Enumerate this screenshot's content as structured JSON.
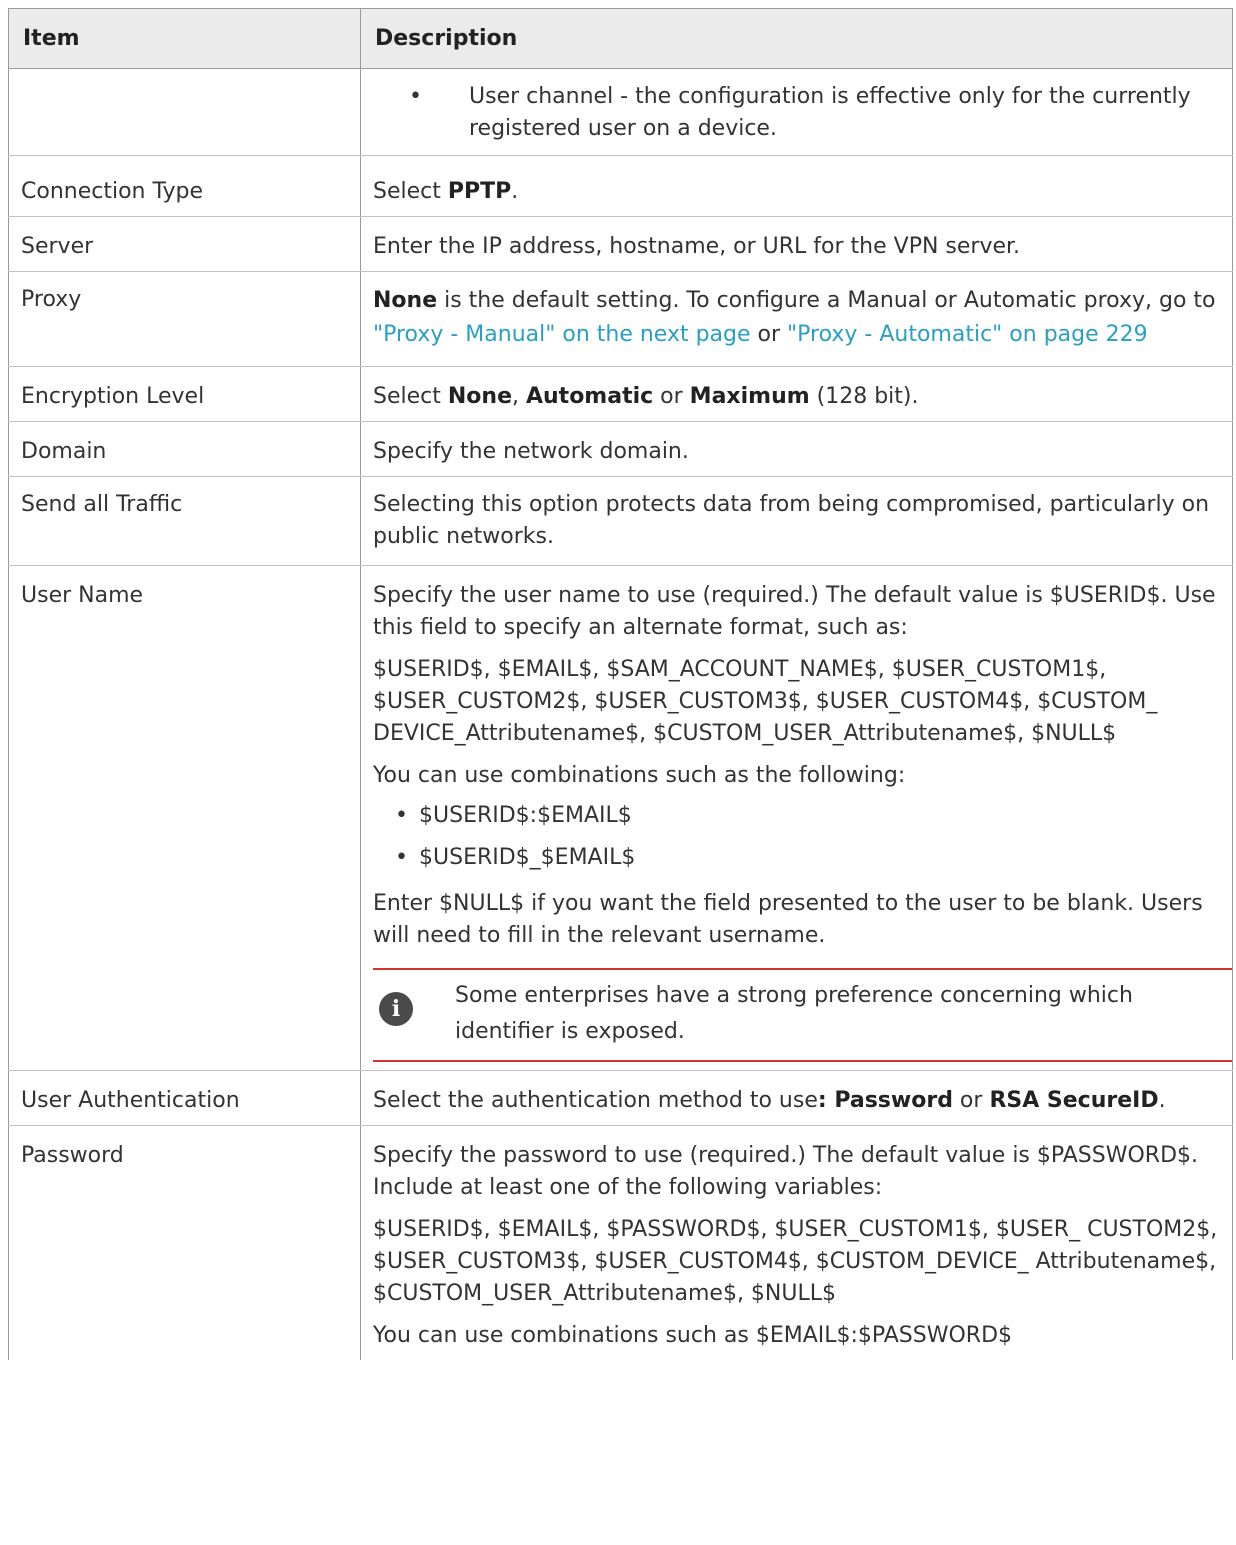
{
  "table": {
    "headers": {
      "item": "Item",
      "description": "Description"
    },
    "user_channel": "User channel - the configuration is effective only for the currently registered user on a device.",
    "connection_type": {
      "item": "Connection Type",
      "pre": "Select ",
      "bold": "PPTP",
      "post": "."
    },
    "server": {
      "item": "Server",
      "text": "Enter the IP address, hostname, or URL for the VPN server."
    },
    "proxy": {
      "item": "Proxy",
      "bold": "None",
      "text1": " is the default setting. To configure a Manual or Automatic proxy, go to ",
      "link1": "\"Proxy - Manual\" on the next page",
      "text2": " or ",
      "link2": "\"Proxy - Automatic\" on page 229"
    },
    "encryption": {
      "item": "Encryption Level",
      "pre": "Select ",
      "opt1": "None",
      "sep1": ", ",
      "opt2": "Automatic",
      "sep2": " or ",
      "opt3": "Maximum",
      "post": " (128 bit)."
    },
    "domain": {
      "item": "Domain",
      "text": "Specify the network domain."
    },
    "send_all": {
      "item": "Send all Traffic",
      "text": "Selecting this option protects data from being compromised, particularly on public networks."
    },
    "user_name": {
      "item": "User Name",
      "p1": "Specify the user name to use (required.) The default value is $USERID$. Use this field to specify an alternate format, such as:",
      "p2": "$USERID$, $EMAIL$, $SAM_ACCOUNT_NAME$, $USER_CUSTOM1$, $USER_CUSTOM2$, $USER_CUSTOM3$, $USER_CUSTOM4$, $CUSTOM_ DEVICE_Attributename$, $CUSTOM_USER_Attributename$, $NULL$",
      "p3": "You can use combinations such as the following:",
      "combos": [
        "$USERID$:$EMAIL$",
        "$USERID$_$EMAIL$"
      ],
      "p4": "Enter $NULL$ if you want the field presented to the user to be blank. Users will need to fill in the relevant username.",
      "note": "Some enterprises have a strong preference concerning which identifier is exposed."
    },
    "user_auth": {
      "item": "User Authentication",
      "pre": "Select the authentication method to use",
      "colon": ":",
      "opt1": " Password",
      "sep": " or ",
      "opt2": "RSA SecureID",
      "post": "."
    },
    "password": {
      "item": "Password",
      "p1": "Specify the password to use (required.) The default value is $PASSWORD$. Include at least one of the following variables:",
      "p2": "$USERID$, $EMAIL$, $PASSWORD$, $USER_CUSTOM1$, $USER_ CUSTOM2$, $USER_CUSTOM3$, $USER_CUSTOM4$, $CUSTOM_DEVICE_ Attributename$, $CUSTOM_USER_Attributename$, $NULL$",
      "p3": "You can use combinations such as $EMAIL$:$PASSWORD$"
    }
  }
}
